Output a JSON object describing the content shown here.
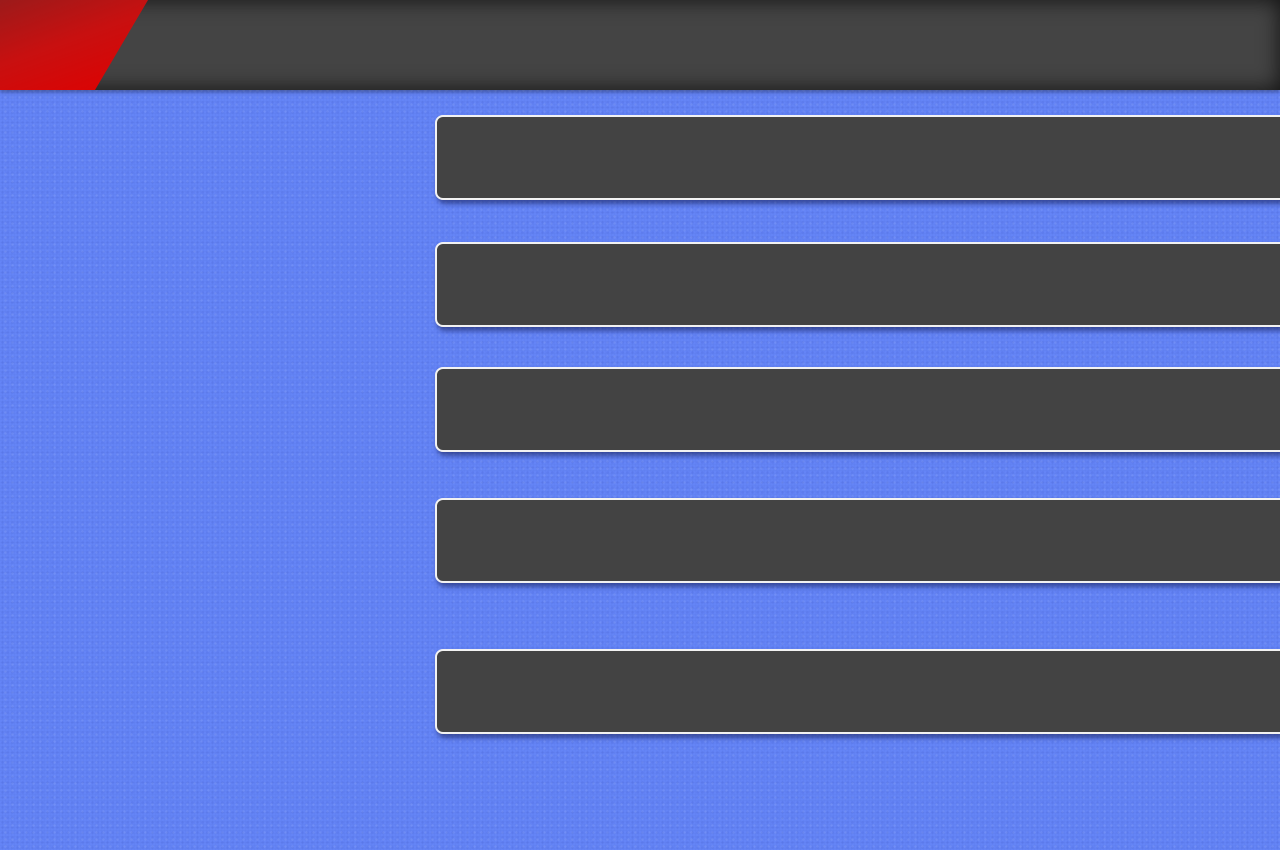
{
  "colors": {
    "background": "#6585f7",
    "top_bar": "#444444",
    "accent": "#e00000",
    "panel_fill": "#434343",
    "panel_border": "#f2f2f2"
  },
  "header": {
    "title": ""
  },
  "menu": {
    "items": [
      {
        "label": ""
      },
      {
        "label": ""
      },
      {
        "label": ""
      },
      {
        "label": ""
      },
      {
        "label": ""
      }
    ]
  }
}
